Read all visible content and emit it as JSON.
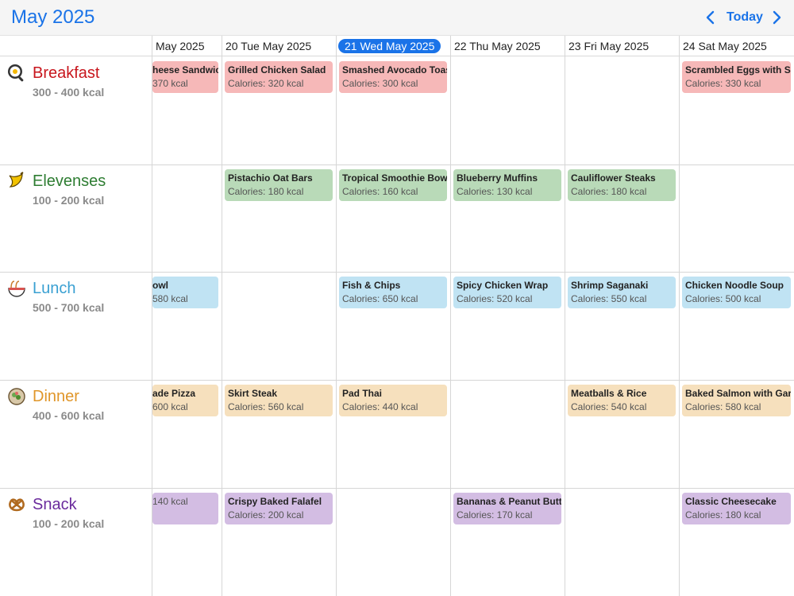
{
  "header": {
    "month_title": "May 2025",
    "today_label": "Today",
    "prev_icon": "chevron-left-icon",
    "next_icon": "chevron-right-icon",
    "accent_color": "#1a73e8"
  },
  "days": [
    {
      "label": "May 2025",
      "partial": true
    },
    {
      "label": "20 Tue May 2025"
    },
    {
      "label": "21 Wed May 2025",
      "today": true
    },
    {
      "label": "22 Thu May 2025"
    },
    {
      "label": "23 Fri May 2025"
    },
    {
      "label": "24 Sat May 2025"
    }
  ],
  "meals": [
    {
      "name": "Breakfast",
      "range": "300 - 400 kcal",
      "color": "#c8161d",
      "event_color": "#f6b8b8",
      "icon": "frying-pan-icon"
    },
    {
      "name": "Elevenses",
      "range": "100 - 200 kcal",
      "color": "#2e7d32",
      "event_color": "#b9dab8",
      "icon": "banana-icon"
    },
    {
      "name": "Lunch",
      "range": "500 - 700 kcal",
      "color": "#3aa0d2",
      "event_color": "#c0e3f3",
      "icon": "noodle-bowl-icon"
    },
    {
      "name": "Dinner",
      "range": "400 - 600 kcal",
      "color": "#e0962a",
      "event_color": "#f6e0bd",
      "icon": "salad-bowl-icon"
    },
    {
      "name": "Snack",
      "range": "100 - 200 kcal",
      "color": "#6a2a9c",
      "event_color": "#d3bde3",
      "icon": "pretzel-icon"
    }
  ],
  "events": {
    "Breakfast": [
      {
        "day": 0,
        "name": "heese Sandwich",
        "kcal": "370 kcal",
        "clipped": true
      },
      {
        "day": 1,
        "name": "Grilled Chicken Salad",
        "kcal": "Calories: 320 kcal"
      },
      {
        "day": 2,
        "name": "Smashed Avocado Toast",
        "kcal": "Calories: 300 kcal"
      },
      {
        "day": 5,
        "name": "Scrambled Eggs with Sp",
        "kcal": "Calories: 330 kcal"
      }
    ],
    "Elevenses": [
      {
        "day": 1,
        "name": "Pistachio Oat Bars",
        "kcal": "Calories: 180 kcal"
      },
      {
        "day": 2,
        "name": "Tropical Smoothie Bowl",
        "kcal": "Calories: 160 kcal"
      },
      {
        "day": 3,
        "name": "Blueberry Muffins",
        "kcal": "Calories: 130 kcal"
      },
      {
        "day": 4,
        "name": "Cauliflower Steaks",
        "kcal": "Calories: 180 kcal"
      }
    ],
    "Lunch": [
      {
        "day": 0,
        "name": "owl",
        "kcal": "580 kcal",
        "clipped": true
      },
      {
        "day": 2,
        "name": "Fish & Chips",
        "kcal": "Calories: 650 kcal"
      },
      {
        "day": 3,
        "name": "Spicy Chicken Wrap",
        "kcal": "Calories: 520 kcal"
      },
      {
        "day": 4,
        "name": "Shrimp Saganaki",
        "kcal": "Calories: 550 kcal"
      },
      {
        "day": 5,
        "name": "Chicken Noodle Soup",
        "kcal": "Calories: 500 kcal"
      }
    ],
    "Dinner": [
      {
        "day": 0,
        "name": "ade Pizza",
        "kcal": "600 kcal",
        "clipped": true
      },
      {
        "day": 1,
        "name": "Skirt Steak",
        "kcal": "Calories: 560 kcal"
      },
      {
        "day": 2,
        "name": "Pad Thai",
        "kcal": "Calories: 440 kcal"
      },
      {
        "day": 4,
        "name": "Meatballs & Rice",
        "kcal": "Calories: 540 kcal"
      },
      {
        "day": 5,
        "name": "Baked Salmon with Garl",
        "kcal": "Calories: 580 kcal"
      }
    ],
    "Snack": [
      {
        "day": 0,
        "name": "",
        "kcal": "140 kcal",
        "clipped": true
      },
      {
        "day": 1,
        "name": "Crispy Baked Falafel",
        "kcal": "Calories: 200 kcal"
      },
      {
        "day": 3,
        "name": "Bananas & Peanut Butte",
        "kcal": "Calories: 170 kcal"
      },
      {
        "day": 5,
        "name": "Classic Cheesecake",
        "kcal": "Calories: 180 kcal"
      }
    ]
  }
}
